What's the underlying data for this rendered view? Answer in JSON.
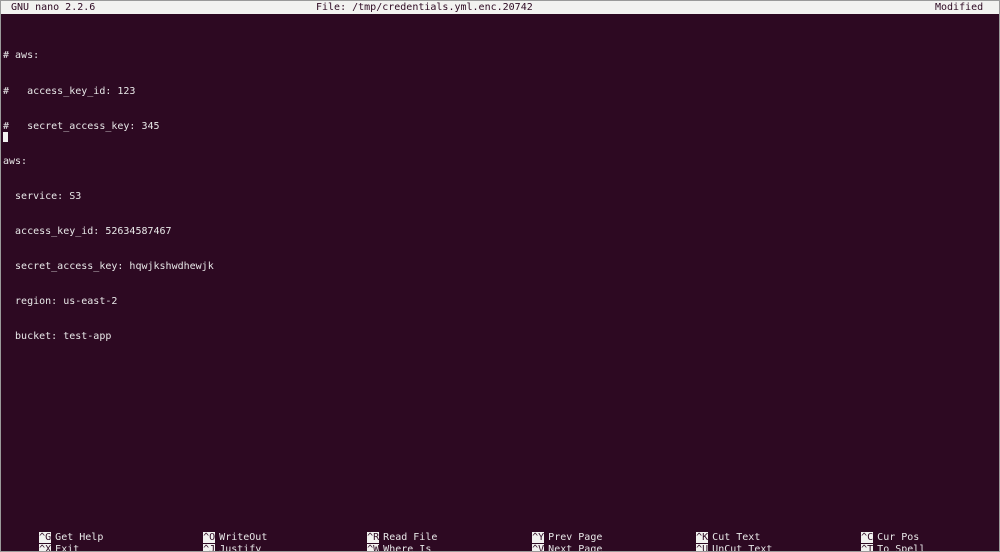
{
  "titlebar": {
    "version": "GNU nano 2.2.6",
    "file": "File: /tmp/credentials.yml.enc.20742",
    "status": "Modified"
  },
  "editor": {
    "lines": [
      "# aws:",
      "#   access_key_id: 123",
      "#   secret_access_key: 345",
      "aws:",
      "  service: S3",
      "  access_key_id: 52634587467",
      "  secret_access_key: hqwjkshwdhewjk",
      "  region: us-east-2",
      "  bucket: test-app"
    ]
  },
  "shortcuts": {
    "row1": [
      {
        "key": "^G",
        "label": "Get Help"
      },
      {
        "key": "^O",
        "label": "WriteOut"
      },
      {
        "key": "^R",
        "label": "Read File"
      },
      {
        "key": "^Y",
        "label": "Prev Page"
      },
      {
        "key": "^K",
        "label": "Cut Text"
      },
      {
        "key": "^C",
        "label": "Cur Pos"
      }
    ],
    "row2": [
      {
        "key": "^X",
        "label": "Exit"
      },
      {
        "key": "^J",
        "label": "Justify"
      },
      {
        "key": "^W",
        "label": "Where Is"
      },
      {
        "key": "^V",
        "label": "Next Page"
      },
      {
        "key": "^U",
        "label": "UnCut Text"
      },
      {
        "key": "^T",
        "label": "To Spell"
      }
    ]
  },
  "colors": {
    "background": "#2d0922",
    "text": "#e8e8e8",
    "bar": "#f2f2f0"
  }
}
